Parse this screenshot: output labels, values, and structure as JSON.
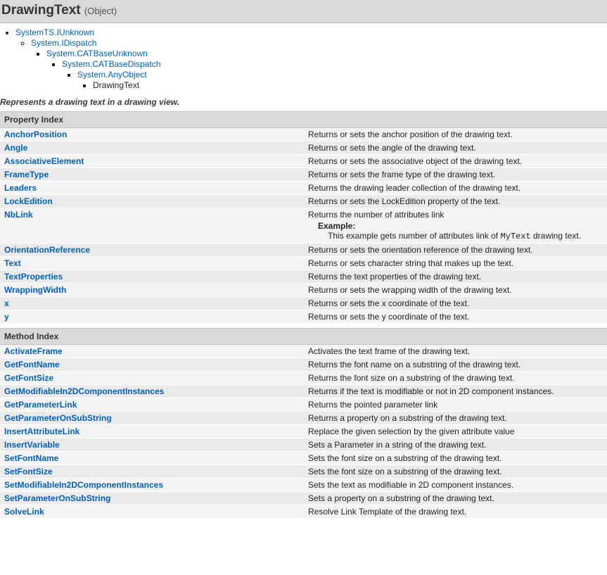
{
  "header": {
    "title": "DrawingText",
    "kind": "(Object)"
  },
  "hierarchy": {
    "l0": "SystemTS.IUnknown",
    "l1": "System.IDispatch",
    "l2": "System.CATBaseUnknown",
    "l3": "System.CATBaseDispatch",
    "l4": "System.AnyObject",
    "l5": "DrawingText"
  },
  "intro": "Represents a drawing text in a drawing view.",
  "property_section_title": "Property Index",
  "method_section_title": "Method Index",
  "nblink_example": {
    "label": "Example:",
    "prefix": "This example gets number of attributes link of ",
    "code": "MyText",
    "suffix": " drawing text."
  },
  "properties": [
    {
      "name": "AnchorPosition",
      "desc": "Returns or sets the anchor position of the drawing text."
    },
    {
      "name": "Angle",
      "desc": "Returns or sets the angle of the drawing text."
    },
    {
      "name": "AssociativeElement",
      "desc": "Returns or sets the associative object of the drawing text."
    },
    {
      "name": "FrameType",
      "desc": "Returns or sets the frame type of the drawing text."
    },
    {
      "name": "Leaders",
      "desc": "Returns the drawing leader collection of the drawing text."
    },
    {
      "name": "LockEdition",
      "desc": "Returns or sets the LockEdition property of the text."
    },
    {
      "name": "NbLink",
      "desc": "Returns the number of attributes link",
      "example": true
    },
    {
      "name": "OrientationReference",
      "desc": "Returns or sets the orientation reference of the drawing text."
    },
    {
      "name": "Text",
      "desc": "Returns or sets character string that makes up the text."
    },
    {
      "name": "TextProperties",
      "desc": "Returns the text properties of the drawing text."
    },
    {
      "name": "WrappingWidth",
      "desc": "Returns or sets the wrapping width of the drawing text."
    },
    {
      "name": "x",
      "desc": "Returns or sets the x coordinate of the text."
    },
    {
      "name": "y",
      "desc": "Returns or sets the y coordinate of the text."
    }
  ],
  "methods": [
    {
      "name": "ActivateFrame",
      "desc": "Activates the text frame of the drawing text."
    },
    {
      "name": "GetFontName",
      "desc": "Returns the font name on a substring of the drawing text."
    },
    {
      "name": "GetFontSize",
      "desc": "Returns the font size on a substring of the drawing text."
    },
    {
      "name": "GetModifiableIn2DComponentInstances",
      "desc": "Returns if the text is modifiable or not in 2D component instances."
    },
    {
      "name": "GetParameterLink",
      "desc": "Returns the pointed parameter link"
    },
    {
      "name": "GetParameterOnSubString",
      "desc": "Returns a property on a substring of the drawing text."
    },
    {
      "name": "InsertAttributeLink",
      "desc": "Replace the given selection by the given attribute value"
    },
    {
      "name": "InsertVariable",
      "desc": "Sets a Parameter in a string of the drawing text."
    },
    {
      "name": "SetFontName",
      "desc": "Sets the font size on a substring of the drawing text."
    },
    {
      "name": "SetFontSize",
      "desc": "Sets the font size on a substring of the drawing text."
    },
    {
      "name": "SetModifiableIn2DComponentInstances",
      "desc": "Sets the text as modifiable in 2D component instances."
    },
    {
      "name": "SetParameterOnSubString",
      "desc": "Sets a property on a substring of the drawing text."
    },
    {
      "name": "SolveLink",
      "desc": "Resolve Link Template of the drawing text."
    }
  ]
}
